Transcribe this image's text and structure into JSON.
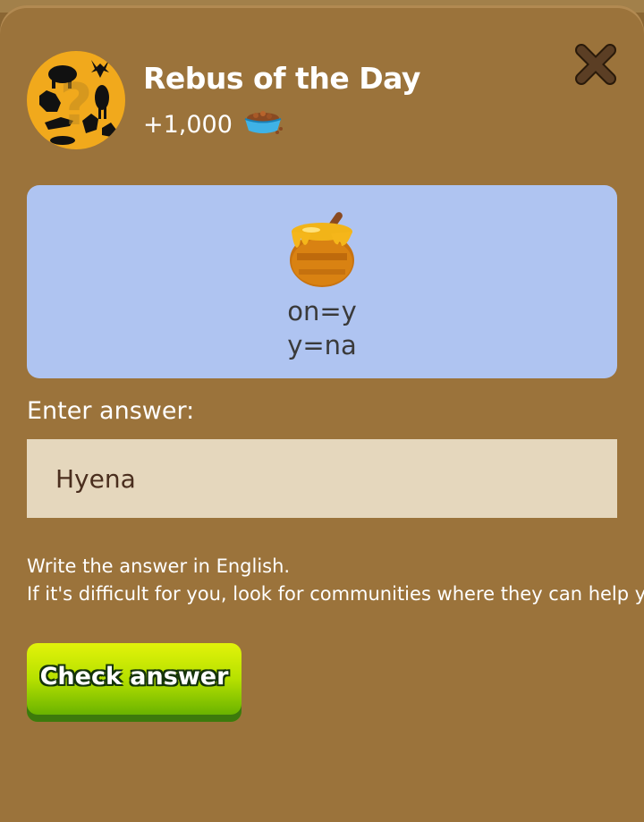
{
  "dialog": {
    "title": "Rebus of the Day",
    "reward_amount": "+1,000",
    "reward_icon": "food-bowl-icon",
    "close_icon": "close-icon"
  },
  "rebus": {
    "image_icon": "honey-pot-icon",
    "line1": "on=y",
    "line2": "y=na",
    "background_color": "#afc4f1"
  },
  "answer": {
    "label": "Enter answer:",
    "value": "Hyena"
  },
  "hints": {
    "line1": "Write the answer in English.",
    "line2": "If it's difficult for you, look for communities where they can help you."
  },
  "check_button": {
    "label": "Check answer",
    "color": "#9bd100"
  },
  "colors": {
    "panel": "#9b733b",
    "avatar_bg": "#f1a91c",
    "input_bg": "#e5d7bd"
  }
}
